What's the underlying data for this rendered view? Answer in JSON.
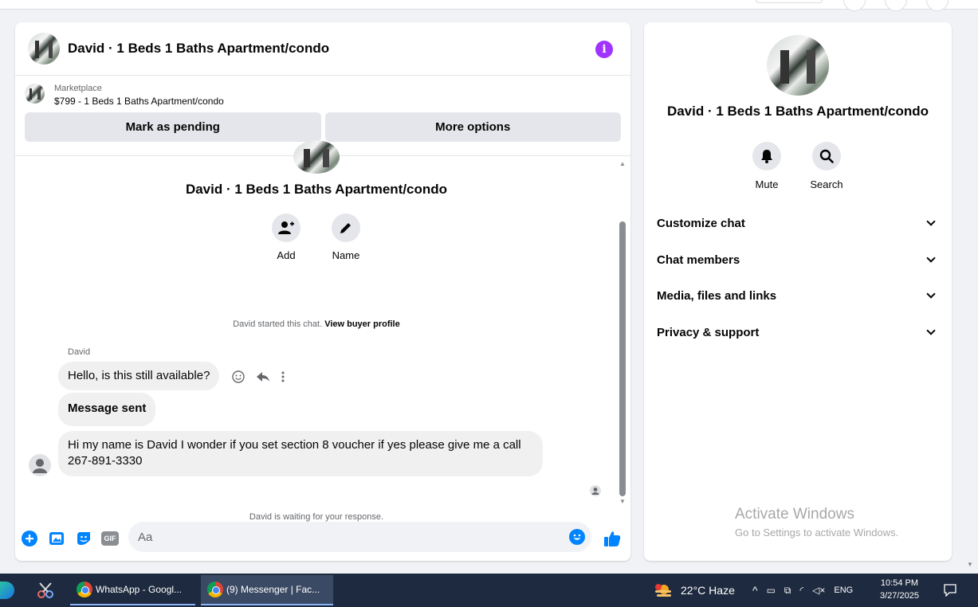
{
  "chat": {
    "title": "David · 1 Beds 1 Baths Apartment/condo",
    "marketplace_label": "Marketplace",
    "listing": "$799 - 1 Beds 1 Baths Apartment/condo",
    "mark_pending": "Mark as pending",
    "more_options": "More options",
    "conversation_name": "David · 1 Beds 1 Baths Apartment/condo",
    "add_label": "Add",
    "name_label": "Name",
    "started_text": "David started this chat.",
    "view_profile": "View buyer profile",
    "sender": "David",
    "msg1": "Hello, is this still available?",
    "msg2": "Message sent",
    "msg3": "Hi my name is David I wonder if you set section 8 voucher if yes please give me a call 267-891-3330",
    "waiting": "David is waiting for your response.",
    "input_placeholder": "Aa",
    "gif_label": "GIF"
  },
  "info": {
    "name": "David · 1 Beds 1 Baths Apartment/condo",
    "mute_label": "Mute",
    "search_label": "Search",
    "sections": [
      "Customize chat",
      "Chat members",
      "Media, files and links",
      "Privacy & support"
    ],
    "watermark_title": "Activate Windows",
    "watermark_sub": "Go to Settings to activate Windows."
  },
  "taskbar": {
    "app1": "WhatsApp - Googl...",
    "app2": "(9) Messenger | Fac...",
    "weather": "22°C  Haze",
    "lang": "ENG",
    "time": "10:54 PM",
    "date": "3/27/2025"
  },
  "colors": {
    "accent": "#0084ff",
    "info_icon": "#a033ff",
    "taskbar": "#1e2a3f"
  }
}
